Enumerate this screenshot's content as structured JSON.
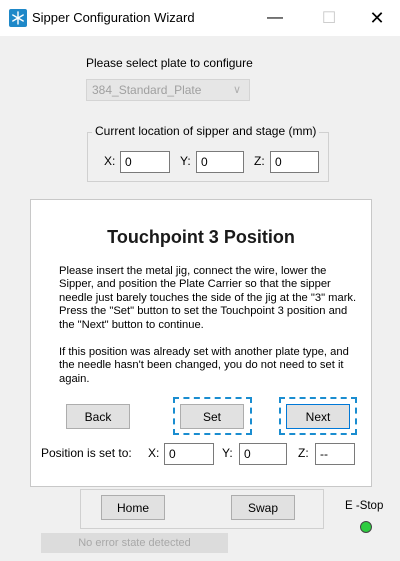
{
  "window": {
    "title": "Sipper Configuration Wizard",
    "minimize_glyph": "—",
    "maximize_glyph": "☐",
    "close_glyph": "✕",
    "icon": "snowflake-icon"
  },
  "plate": {
    "prompt": "Please select plate to configure",
    "selected": "384_Standard_Plate"
  },
  "location": {
    "legend": "Current location of sipper and stage (mm)",
    "x_label": "X:",
    "x_value": "0",
    "y_label": "Y:",
    "y_value": "0",
    "z_label": "Z:",
    "z_value": "0"
  },
  "touchpoint": {
    "title": "Touchpoint 3 Position",
    "instructions_1": "Please insert the metal jig, connect the wire, lower the Sipper, and position the Plate Carrier so that the sipper needle just barely touches the side of the jig at the \"3\" mark. Press the \"Set\" button to set the Touchpoint 3 position and the \"Next\" button to continue.",
    "instructions_2": "If this position was already set with another plate type, and the needle hasn't been changed, you do not need to set it again."
  },
  "buttons": {
    "back": "Back",
    "set": "Set",
    "next": "Next",
    "home": "Home",
    "swap": "Swap"
  },
  "position": {
    "label": "Position is set to:",
    "x_label": "X:",
    "x_value": "0",
    "y_label": "Y:",
    "y_value": "0",
    "z_label": "Z:",
    "z_value": "--"
  },
  "estop": {
    "label": "E -Stop",
    "color": "#2ecc40"
  },
  "status": {
    "text": "No error state detected"
  },
  "colors": {
    "highlight": "#1a8dd0",
    "focus": "#0078d7"
  }
}
